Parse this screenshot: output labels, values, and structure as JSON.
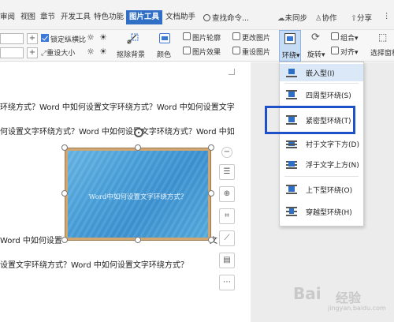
{
  "menubar": {
    "tabs": [
      "审阅",
      "视图",
      "章节",
      "开发工具",
      "特色功能",
      "图片工具",
      "文档助手"
    ],
    "active_tab": "图片工具",
    "search_label": "查找命令...",
    "sync_label": "未同步",
    "collab_label": "协作",
    "share_label": "分享"
  },
  "ribbon": {
    "lock_ratio_label": "锁定纵横比",
    "reset_size_label": "重设大小",
    "cutout_label": "抠除背景",
    "color_label": "颜色",
    "outline_label": "图片轮廓",
    "effects_label": "图片效果",
    "change_label": "更改图片",
    "reset_label": "重设图片",
    "wrap_label": "环绕",
    "rotate_label": "旋转",
    "group_label": "组合",
    "align_label": "对齐",
    "select_label": "选择窗格"
  },
  "document": {
    "lines": [
      "环绕方式？Word 中如何设置文字环绕方式？Word 中如何设置文字",
      "何设置文字环绕方式？Word 中如何设置文字环绕方式？Word 中如",
      "Word 中如何设置",
      "设置文字环绕方式？Word 中如何设置文字环绕方式？"
    ],
    "right_fragment": "文",
    "image_caption": "Word中如何设置文字环绕方式？"
  },
  "wrap_menu": {
    "items": [
      "嵌入型(I)",
      "四周型环绕(S)",
      "紧密型环绕(T)",
      "衬于文字下方(D)",
      "浮于文字上方(N)",
      "上下型环绕(O)",
      "穿越型环绕(H)"
    ],
    "selected_index": 0,
    "highlighted_index": 2
  },
  "watermark": {
    "brand": "Bai",
    "brand_cn": "经验",
    "url": "jingyan.baidu.com"
  },
  "colors": {
    "accent": "#2f6fc6",
    "highlight_box": "#2050c8",
    "image_frame": "#d2a670",
    "image_fill": "#4aa1db"
  }
}
